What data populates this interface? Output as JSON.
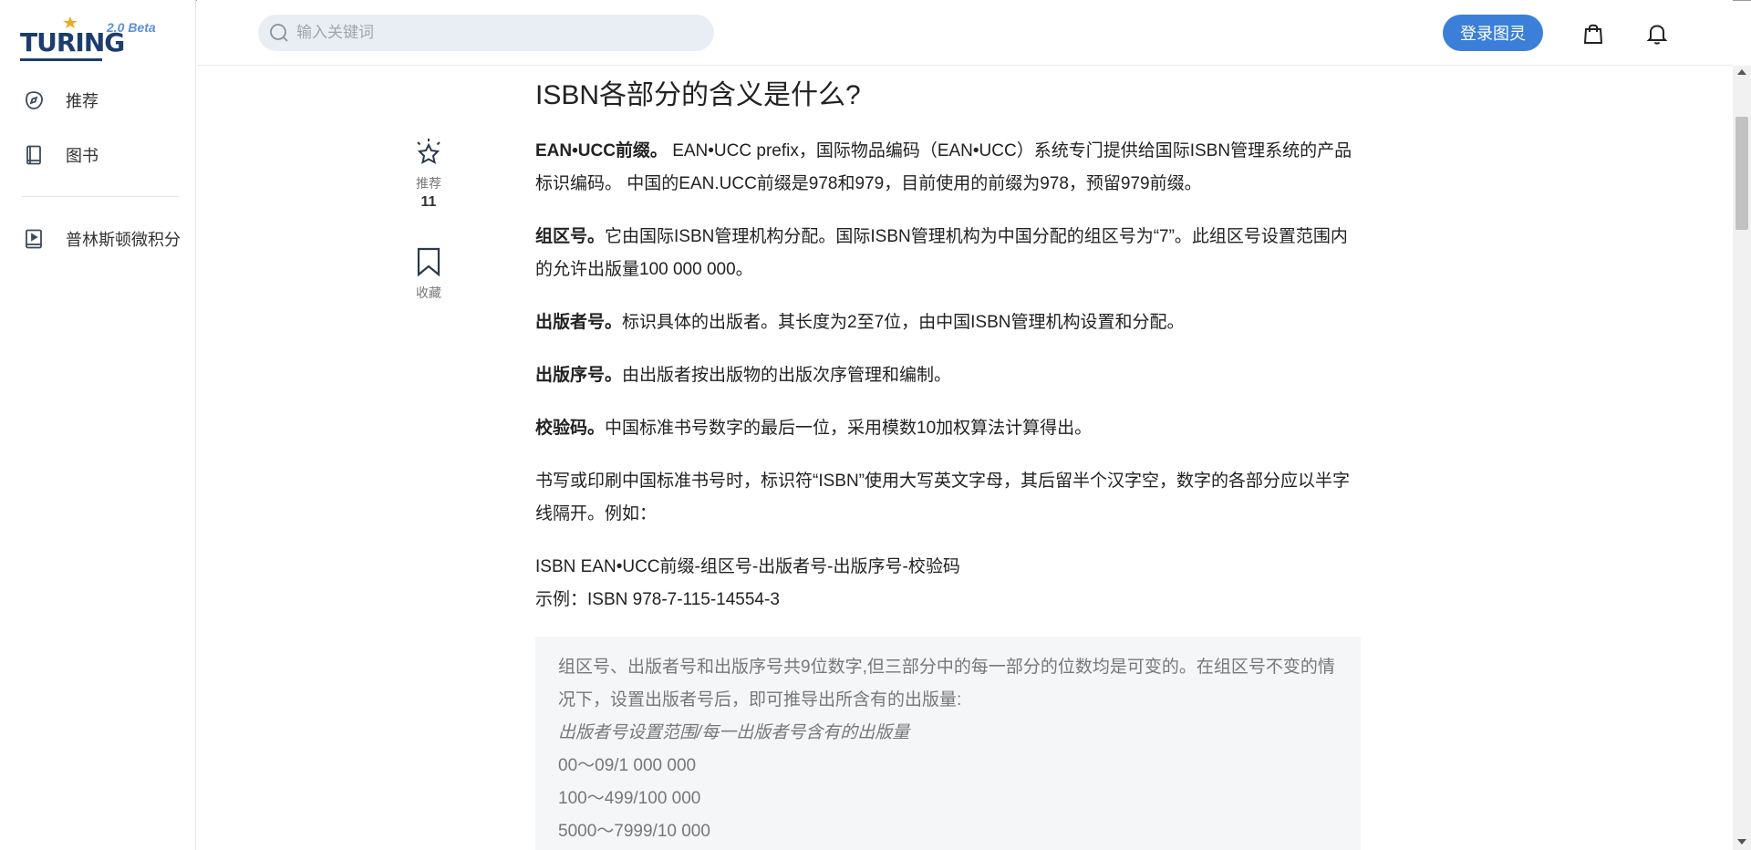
{
  "sidebar": {
    "logo_text": "TURING",
    "logo_version": "2.0 Beta",
    "items": [
      {
        "label": "推荐",
        "icon": "compass-icon"
      },
      {
        "label": "图书",
        "icon": "book-icon"
      },
      {
        "label": "普林斯顿微积分",
        "icon": "video-book-icon"
      }
    ]
  },
  "header": {
    "search_placeholder": "输入关键词",
    "login_label": "登录图灵",
    "icons": [
      "shopping-bag-icon",
      "bell-icon"
    ]
  },
  "actions": {
    "recommend_label": "推荐",
    "recommend_count": "11",
    "bookmark_label": "收藏"
  },
  "article": {
    "title": "ISBN各部分的含义是什么?",
    "p1_bold": "EAN•UCC前缀。",
    "p1_text": " EAN•UCC prefix，国际物品编码（EAN•UCC）系统专门提供给国际ISBN管理系统的产品标识编码。 中国的EAN.UCC前缀是978和979，目前使用的前缀为978，预留979前缀。",
    "p2_bold": "组区号。",
    "p2_text": "它由国际ISBN管理机构分配。国际ISBN管理机构为中国分配的组区号为“7”。此组区号设置范围内的允许出版量100 000 000。",
    "p3_bold": "出版者号。",
    "p3_text": "标识具体的出版者。其长度为2至7位，由中国ISBN管理机构设置和分配。",
    "p4_bold": "出版序号。",
    "p4_text": "由出版者按出版物的出版次序管理和编制。",
    "p5_bold": "校验码。",
    "p5_text": "中国标准书号数字的最后一位，采用模数10加权算法计算得出。",
    "p6_text": "书写或印刷中国标准书号时，标识符“ISBN”使用大写英文字母，其后留半个汉字空，数字的各部分应以半字线隔开。例如：",
    "p7_line1": "ISBN EAN•UCC前缀-组区号-出版者号-出版序号-校验码",
    "p7_line2": "示例：ISBN 978-7-115-14554-3",
    "quote_text": "组区号、出版者号和出版序号共9位数字,但三部分中的每一部分的位数均是可变的。在组区号不变的情况下，设置出版者号后，即可推导出所含有的出版量:",
    "quote_italic": "出版者号设置范围/每一出版者号含有的出版量",
    "quote_rows": [
      "00～09/1 000 000",
      "100～499/100 000",
      "5000～7999/10 000"
    ]
  }
}
